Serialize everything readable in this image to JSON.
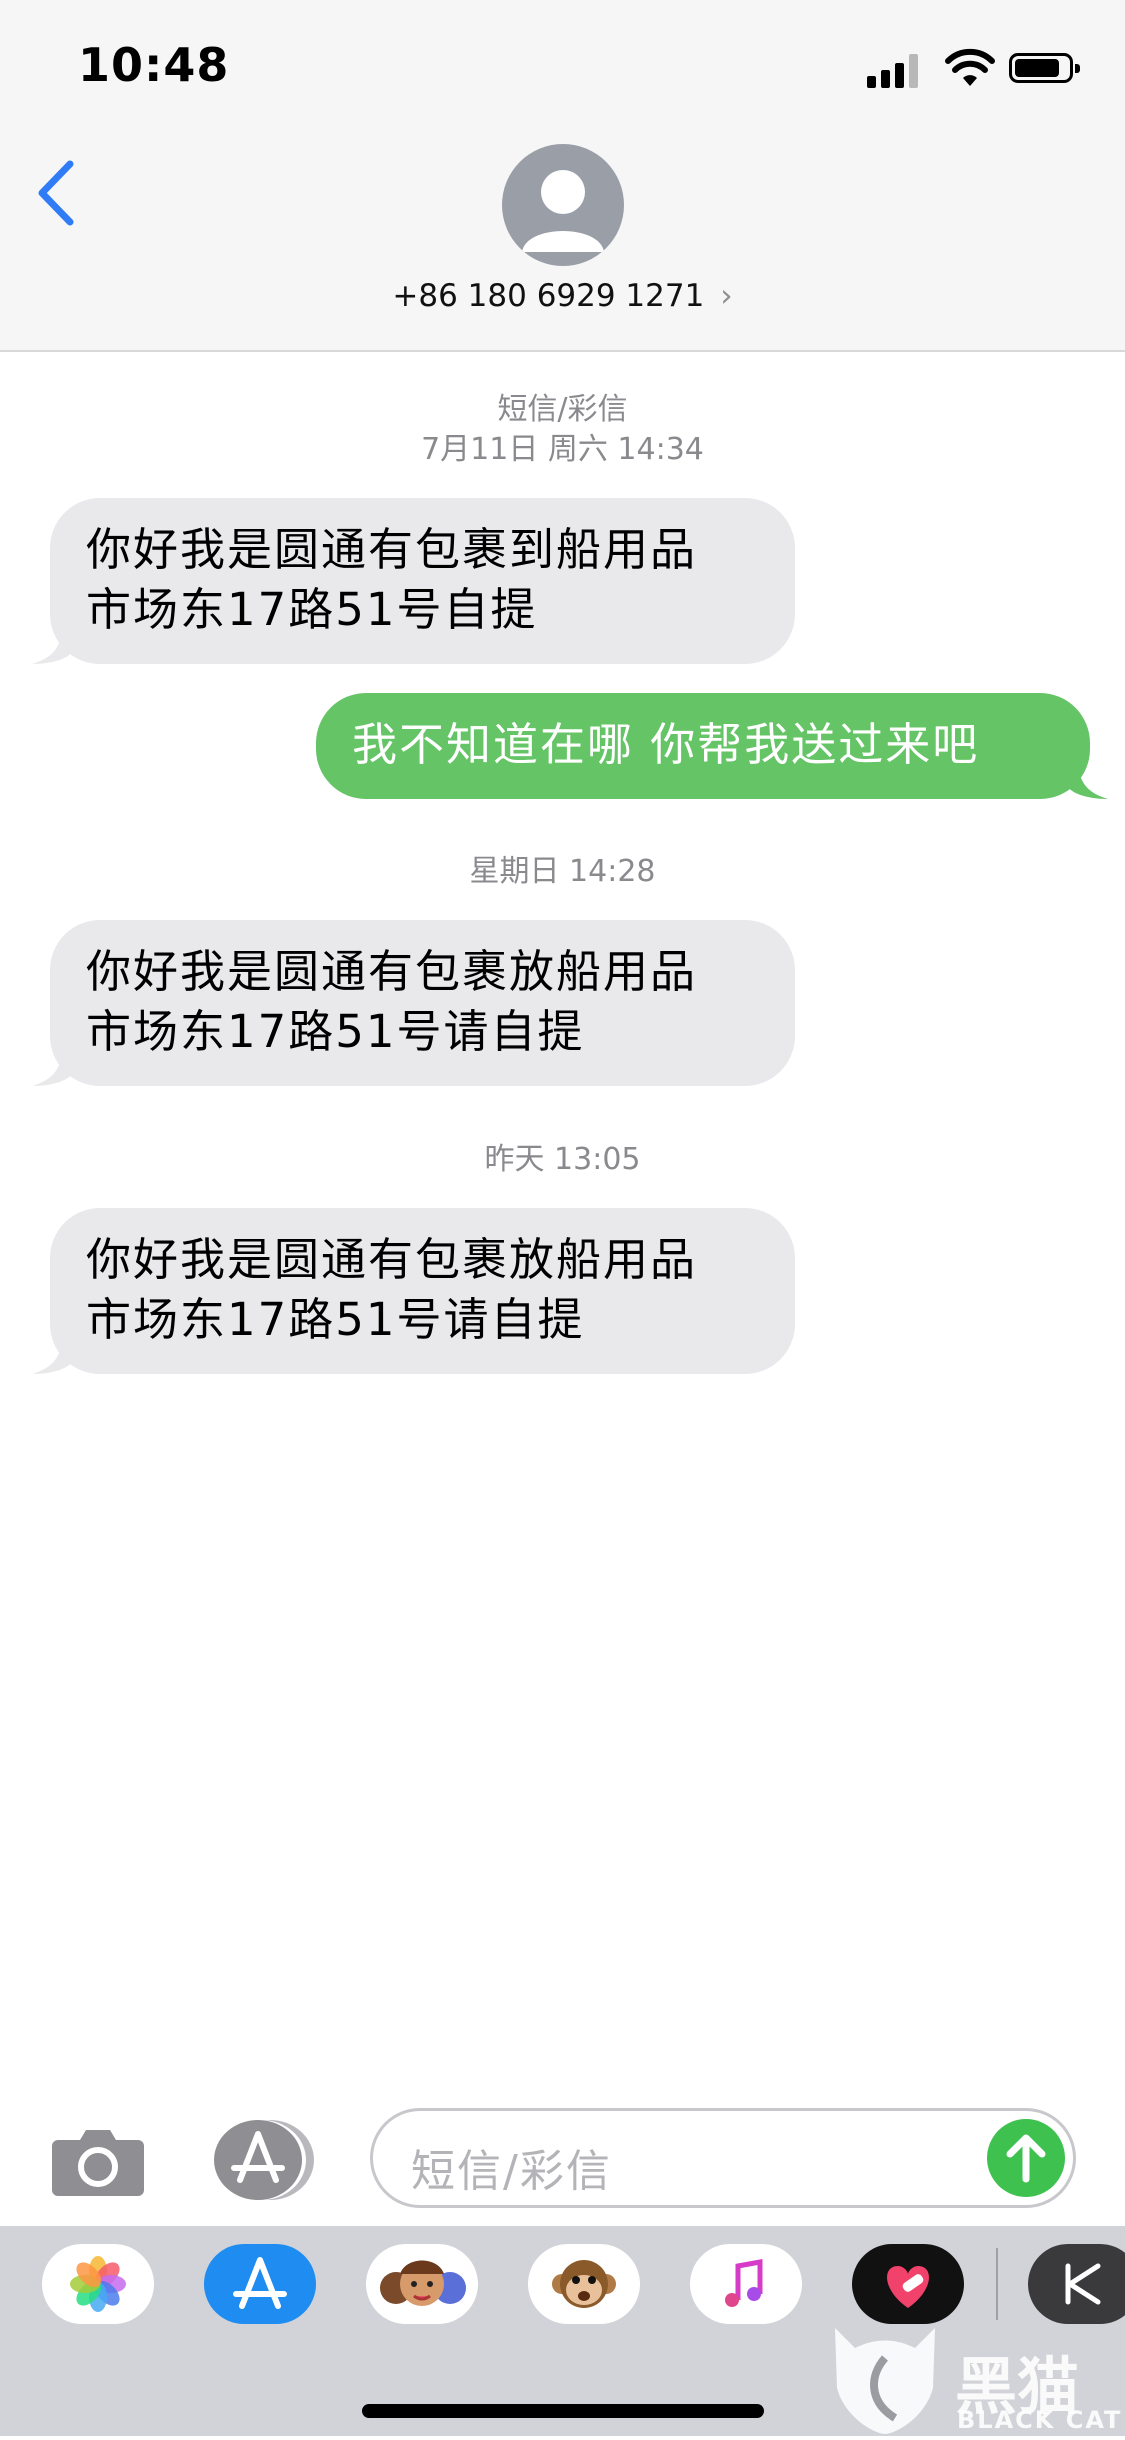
{
  "status_bar": {
    "time": "10:48"
  },
  "header": {
    "contact": "+86 180 6929 1271",
    "chevron": "›"
  },
  "messages": {
    "ts1_line1": "短信/彩信",
    "ts1_line2": "7月11日 周六 14:34",
    "m1_line1": "你好我是圆通有包裹到船用品",
    "m1_line2": "市场东17路51号自提",
    "m2": "我不知道在哪 你帮我送过来吧",
    "ts2": "星期日 14:28",
    "m3_line1": "你好我是圆通有包裹放船用品",
    "m3_line2": "市场东17路51号请自提",
    "ts3": "昨天 13:05",
    "m4_line1": "你好我是圆通有包裹放船用品",
    "m4_line2": "市场东17路51号请自提"
  },
  "input": {
    "placeholder": "短信/彩信"
  },
  "drawer_apps": [
    "photos-icon",
    "app-store-icon",
    "memoji-icon",
    "animoji-monkey-icon",
    "music-icon",
    "heart-app-icon",
    "k-app-icon"
  ],
  "watermark": {
    "text": "黑猫",
    "sub": "BLACK CAT"
  },
  "colors": {
    "outgoing": "#64c466",
    "incoming": "#e9e9eb",
    "accent": "#2f7cf6",
    "send": "#3ec14f"
  }
}
